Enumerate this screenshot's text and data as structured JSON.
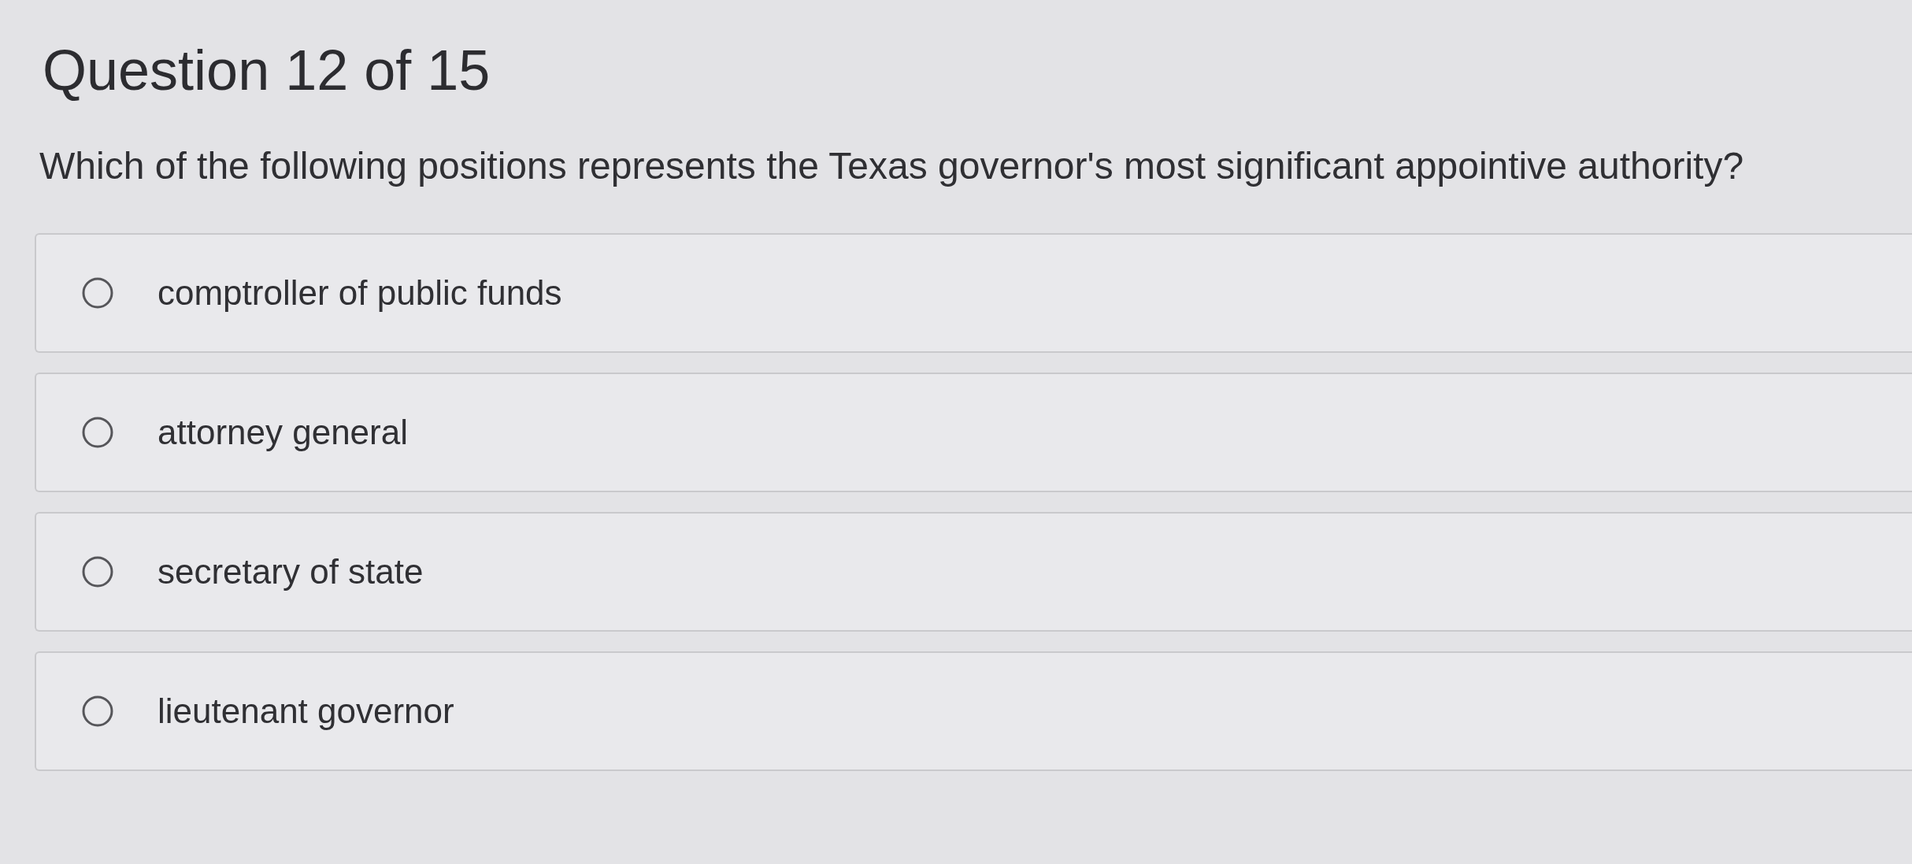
{
  "question": {
    "header": "Question 12 of 15",
    "prompt": "Which of the following positions represents the Texas governor's most significant appointive authority?"
  },
  "options": [
    {
      "label": "comptroller of public funds",
      "selected": false
    },
    {
      "label": "attorney general",
      "selected": false
    },
    {
      "label": "secretary of state",
      "selected": false
    },
    {
      "label": "lieutenant governor",
      "selected": false
    }
  ]
}
